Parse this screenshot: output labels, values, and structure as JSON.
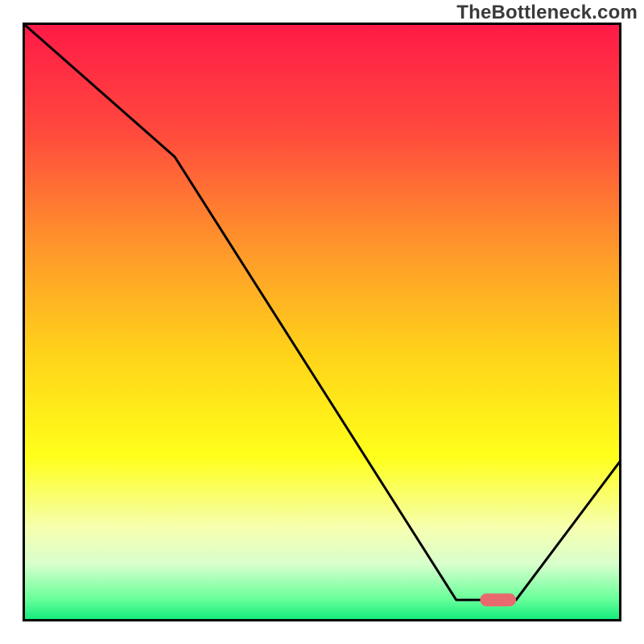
{
  "watermark": "TheBottleneck.com",
  "colors": {
    "border": "#000000",
    "curve": "#000000",
    "marker": "#e86a6e",
    "gradient_stops": [
      {
        "offset": 0.0,
        "color": "#ff1a47"
      },
      {
        "offset": 0.18,
        "color": "#ff4a3d"
      },
      {
        "offset": 0.38,
        "color": "#ff9a2a"
      },
      {
        "offset": 0.55,
        "color": "#ffd31a"
      },
      {
        "offset": 0.72,
        "color": "#ffff1a"
      },
      {
        "offset": 0.84,
        "color": "#f6ffb0"
      },
      {
        "offset": 0.9,
        "color": "#d8ffcc"
      },
      {
        "offset": 0.96,
        "color": "#66ff99"
      },
      {
        "offset": 1.0,
        "color": "#00e676"
      }
    ]
  },
  "chart_data": {
    "type": "line",
    "title": "",
    "xlabel": "",
    "ylabel": "",
    "xlim": [
      0,
      100
    ],
    "ylim": [
      0,
      100
    ],
    "series": [
      {
        "name": "bottleneck-curve",
        "x": [
          0,
          25,
          72,
          76,
          82,
          100
        ],
        "values": [
          100,
          78,
          4,
          4,
          4,
          28
        ]
      }
    ],
    "annotations": [
      {
        "name": "optimal-marker",
        "shape": "rounded-bar",
        "x_start": 76,
        "x_end": 82,
        "y": 4,
        "color": "#e86a6e"
      }
    ],
    "grid": false,
    "legend": false
  }
}
